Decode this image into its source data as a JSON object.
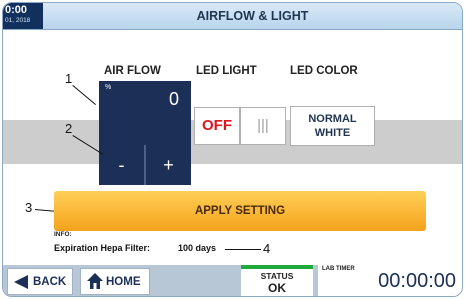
{
  "header": {
    "time": "0:00",
    "date": "01, 2018",
    "title": "AIRFLOW & LIGHT"
  },
  "airflow": {
    "label": "AIR FLOW",
    "unit": "%",
    "value": "0",
    "minus_label": "-",
    "plus_label": "+"
  },
  "led_light": {
    "label": "LED LIGHT",
    "off_label": "OFF",
    "on_label": "|||"
  },
  "led_color": {
    "label": "LED COLOR",
    "line1": "NORMAL",
    "line2": "WHITE"
  },
  "callouts": [
    "1",
    "2",
    "3",
    "4"
  ],
  "apply_button": "APPLY SETTING",
  "info": {
    "label": "INFO:",
    "hepa_label": "Expiration Hepa Filter:",
    "hepa_value": "100 days"
  },
  "footer": {
    "back_label": "BACK",
    "home_label": "HOME",
    "status_label": "STATUS",
    "status_value": "OK",
    "status_color": "#1eaa3c",
    "timer_label": "LAB TIMER",
    "timer_value": "00:00:00"
  },
  "colors": {
    "accent_navy": "#1b2f57",
    "apply_orange": "#f5a21c",
    "off_red": "#e0141e"
  }
}
